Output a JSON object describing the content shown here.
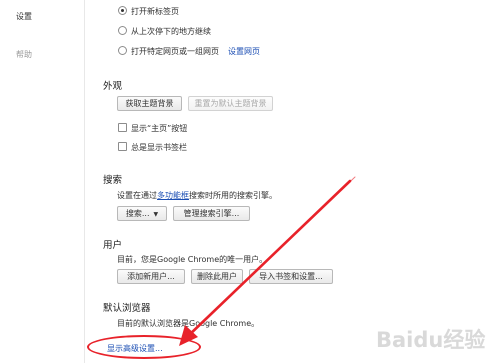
{
  "sidebar": {
    "items": [
      {
        "label": "设置"
      },
      {
        "label": "帮助"
      }
    ]
  },
  "startup": {
    "options": [
      {
        "label": "打开新标签页",
        "checked": true
      },
      {
        "label": "从上次停下的地方继续",
        "checked": false
      },
      {
        "label": "打开特定网页或一组网页",
        "checked": false
      }
    ],
    "set_pages_link": "设置网页"
  },
  "appearance": {
    "title": "外观",
    "get_themes_button": "获取主题背景",
    "reset_theme_button": "重置为默认主题背景",
    "show_home_label": "显示“主页”按钮",
    "show_bookmarks_label": "总是显示书签栏"
  },
  "search": {
    "title": "搜索",
    "desc_prefix": "设置在通过",
    "desc_link": "多功能框",
    "desc_suffix": "搜索时所用的搜索引擎。",
    "engine_dropdown": "搜索...",
    "manage_button": "管理搜索引擎..."
  },
  "users": {
    "title": "用户",
    "desc": "目前，您是Google Chrome的唯一用户。",
    "add_button": "添加新用户...",
    "delete_button": "删除此用户",
    "import_button": "导入书签和设置..."
  },
  "default_browser": {
    "title": "默认浏览器",
    "desc": "目前的默认浏览器是Google Chrome。"
  },
  "advanced_link": "显示高级设置...",
  "watermark": "Baidu经验",
  "colors": {
    "annotation_red": "#e8222a",
    "link_blue": "#1a4db3"
  }
}
